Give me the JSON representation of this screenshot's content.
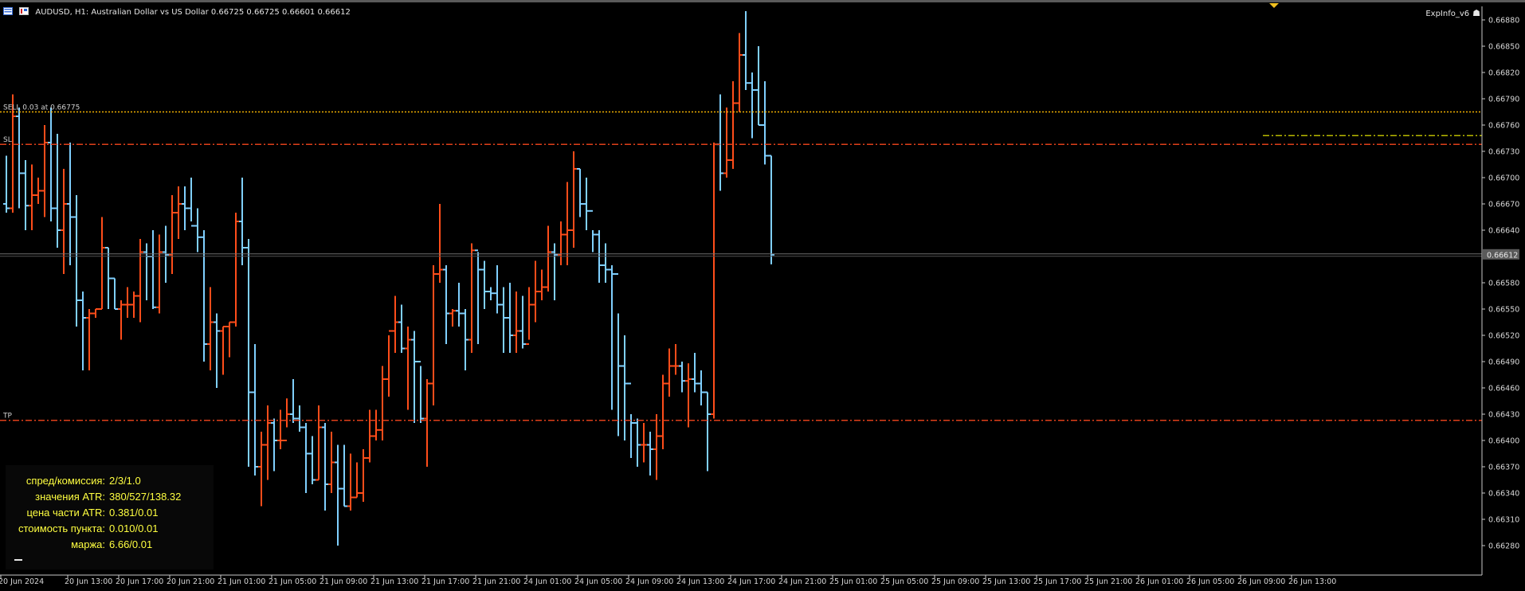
{
  "window": {
    "symbol_title": "AUDUSD, H1:  Australian Dollar vs US Dollar  0.66725 0.66725 0.66601 0.66612",
    "indicator_label": "ExpInfo_v6"
  },
  "levels": {
    "sell": {
      "label": "SELL 0.03 at 0.66775",
      "price": 0.66775,
      "color": "#f0b000"
    },
    "sl": {
      "label": "SL",
      "price": 0.66738,
      "color": "#e0401a"
    },
    "tp": {
      "label": "TP",
      "price": 0.66423,
      "color": "#e0401a"
    },
    "bid": {
      "label": "0.66612",
      "price": 0.66612,
      "color": "#8a8a8a"
    },
    "extra_dash_color": "#b8b800"
  },
  "colors": {
    "bull": "#ff4d1a",
    "bear": "#80d0ff",
    "grid_text": "#d8d8d8",
    "panel_text": "#ffff40"
  },
  "info_panel": [
    {
      "label": "спред/комиссия:",
      "value": "2/3/1.0"
    },
    {
      "label": "значения ATR:",
      "value": "380/527/138.32"
    },
    {
      "label": "цена части ATR:",
      "value": "0.381/0.01"
    },
    {
      "label": "стоимость пункта:",
      "value": "0.010/0.01"
    },
    {
      "label": "маржа:",
      "value": "6.66/0.01"
    }
  ],
  "chart_data": {
    "type": "ohlc",
    "title": "AUDUSD, H1",
    "y_ticks": [
      "0.66880",
      "0.66850",
      "0.66820",
      "0.66790",
      "0.66760",
      "0.66730",
      "0.66700",
      "0.66670",
      "0.66640",
      "0.66580",
      "0.66550",
      "0.66520",
      "0.66490",
      "0.66460",
      "0.66430",
      "0.66400",
      "0.66370",
      "0.66340",
      "0.66310",
      "0.66280"
    ],
    "ylim": [
      0.6625,
      0.66895
    ],
    "x_ticks": [
      "20 Jun 2024",
      "20 Jun 13:00",
      "20 Jun 17:00",
      "20 Jun 21:00",
      "21 Jun 01:00",
      "21 Jun 05:00",
      "21 Jun 09:00",
      "21 Jun 13:00",
      "21 Jun 17:00",
      "21 Jun 21:00",
      "24 Jun 01:00",
      "24 Jun 05:00",
      "24 Jun 09:00",
      "24 Jun 13:00",
      "24 Jun 17:00",
      "24 Jun 21:00",
      "25 Jun 01:00",
      "25 Jun 05:00",
      "25 Jun 09:00",
      "25 Jun 13:00",
      "25 Jun 17:00",
      "25 Jun 21:00",
      "26 Jun 01:00",
      "26 Jun 05:00",
      "26 Jun 09:00",
      "26 Jun 13:00"
    ],
    "bars": [
      [
        0.6667,
        0.66725,
        0.6666,
        0.66665
      ],
      [
        0.66665,
        0.66795,
        0.6666,
        0.6677
      ],
      [
        0.6677,
        0.6678,
        0.66665,
        0.66705
      ],
      [
        0.66705,
        0.6672,
        0.6664,
        0.66668
      ],
      [
        0.66668,
        0.66715,
        0.6664,
        0.6668
      ],
      [
        0.6668,
        0.667,
        0.6667,
        0.66685
      ],
      [
        0.66685,
        0.6676,
        0.66655,
        0.6674
      ],
      [
        0.6674,
        0.6678,
        0.6665,
        0.66665
      ],
      [
        0.66665,
        0.6675,
        0.6662,
        0.6664
      ],
      [
        0.6664,
        0.6671,
        0.6659,
        0.6667
      ],
      [
        0.6667,
        0.6674,
        0.666,
        0.66655
      ],
      [
        0.66655,
        0.6668,
        0.6653,
        0.6656
      ],
      [
        0.6656,
        0.6657,
        0.6648,
        0.6654
      ],
      [
        0.6654,
        0.6655,
        0.6648,
        0.66545
      ],
      [
        0.66545,
        0.6655,
        0.6654,
        0.6655
      ],
      [
        0.6655,
        0.66655,
        0.6655,
        0.6662
      ],
      [
        0.6662,
        0.6662,
        0.6655,
        0.66585
      ],
      [
        0.66585,
        0.66585,
        0.6655,
        0.6655
      ],
      [
        0.6655,
        0.6656,
        0.66515,
        0.66555
      ],
      [
        0.66555,
        0.66575,
        0.6654,
        0.66555
      ],
      [
        0.66555,
        0.6657,
        0.6654,
        0.66565
      ],
      [
        0.66565,
        0.6663,
        0.66535,
        0.66615
      ],
      [
        0.66615,
        0.66625,
        0.6656,
        0.6661
      ],
      [
        0.6661,
        0.6664,
        0.6655,
        0.66552
      ],
      [
        0.66552,
        0.66635,
        0.66545,
        0.66615
      ],
      [
        0.66615,
        0.66645,
        0.6658,
        0.66612
      ],
      [
        0.66612,
        0.6668,
        0.6659,
        0.6666
      ],
      [
        0.6666,
        0.6669,
        0.6663,
        0.6667
      ],
      [
        0.6667,
        0.6669,
        0.6664,
        0.66665
      ],
      [
        0.66665,
        0.667,
        0.6665,
        0.66645
      ],
      [
        0.66645,
        0.66665,
        0.66615,
        0.66632
      ],
      [
        0.66632,
        0.6664,
        0.6649,
        0.6651
      ],
      [
        0.6651,
        0.66575,
        0.6648,
        0.66535
      ],
      [
        0.66535,
        0.66545,
        0.6646,
        0.66525
      ],
      [
        0.66525,
        0.6653,
        0.66475,
        0.6653
      ],
      [
        0.6653,
        0.66535,
        0.66495,
        0.66535
      ],
      [
        0.66535,
        0.6666,
        0.6653,
        0.6665
      ],
      [
        0.6665,
        0.667,
        0.666,
        0.6662
      ],
      [
        0.6662,
        0.6663,
        0.6637,
        0.66455
      ],
      [
        0.66455,
        0.6651,
        0.6636,
        0.6637
      ],
      [
        0.6637,
        0.6641,
        0.66325,
        0.66395
      ],
      [
        0.66395,
        0.6644,
        0.66355,
        0.6642
      ],
      [
        0.6642,
        0.66425,
        0.66365,
        0.664
      ],
      [
        0.664,
        0.66435,
        0.6639,
        0.664
      ],
      [
        0.664,
        0.66448,
        0.66415,
        0.6643
      ],
      [
        0.6643,
        0.6647,
        0.6642,
        0.66425
      ],
      [
        0.66425,
        0.6644,
        0.6641,
        0.66415
      ],
      [
        0.66415,
        0.6642,
        0.6634,
        0.66385
      ],
      [
        0.66385,
        0.66405,
        0.6635,
        0.66355
      ],
      [
        0.66355,
        0.6644,
        0.66355,
        0.66415
      ],
      [
        0.66415,
        0.6642,
        0.6632,
        0.6635
      ],
      [
        0.6635,
        0.6641,
        0.6634,
        0.66375
      ],
      [
        0.66375,
        0.66395,
        0.6628,
        0.66345
      ],
      [
        0.66345,
        0.66395,
        0.66325,
        0.66325
      ],
      [
        0.66325,
        0.66385,
        0.6632,
        0.66335
      ],
      [
        0.66335,
        0.66375,
        0.66335,
        0.6634
      ],
      [
        0.6634,
        0.6639,
        0.6633,
        0.6638
      ],
      [
        0.6638,
        0.66435,
        0.66375,
        0.66405
      ],
      [
        0.66405,
        0.66435,
        0.664,
        0.66412
      ],
      [
        0.66412,
        0.66485,
        0.664,
        0.6647
      ],
      [
        0.6647,
        0.6652,
        0.6645,
        0.66525
      ],
      [
        0.66525,
        0.66565,
        0.665,
        0.66535
      ],
      [
        0.66535,
        0.66555,
        0.665,
        0.66505
      ],
      [
        0.66505,
        0.6653,
        0.66435,
        0.66515
      ],
      [
        0.66515,
        0.66525,
        0.6642,
        0.6649
      ],
      [
        0.6649,
        0.66485,
        0.6642,
        0.66425
      ],
      [
        0.66425,
        0.6647,
        0.6637,
        0.66465
      ],
      [
        0.66465,
        0.666,
        0.6644,
        0.6659
      ],
      [
        0.6659,
        0.6667,
        0.6658,
        0.66595
      ],
      [
        0.66595,
        0.666,
        0.6651,
        0.66545
      ],
      [
        0.66545,
        0.6655,
        0.6653,
        0.66548
      ],
      [
        0.66548,
        0.6658,
        0.6653,
        0.66545
      ],
      [
        0.66545,
        0.6655,
        0.6648,
        0.66515
      ],
      [
        0.66515,
        0.66625,
        0.665,
        0.66617
      ],
      [
        0.66617,
        0.66615,
        0.6651,
        0.66595
      ],
      [
        0.66595,
        0.66605,
        0.6655,
        0.6657
      ],
      [
        0.6657,
        0.66575,
        0.6656,
        0.66568
      ],
      [
        0.66568,
        0.666,
        0.66545,
        0.66555
      ],
      [
        0.66555,
        0.66575,
        0.665,
        0.6654
      ],
      [
        0.6654,
        0.6658,
        0.665,
        0.6652
      ],
      [
        0.6652,
        0.6657,
        0.665,
        0.66525
      ],
      [
        0.66525,
        0.66565,
        0.66505,
        0.6651
      ],
      [
        0.6651,
        0.66575,
        0.66515,
        0.66555
      ],
      [
        0.66555,
        0.66605,
        0.66535,
        0.6657
      ],
      [
        0.6657,
        0.66595,
        0.6656,
        0.66575
      ],
      [
        0.66575,
        0.66645,
        0.6657,
        0.66615
      ],
      [
        0.66615,
        0.66625,
        0.6656,
        0.66612
      ],
      [
        0.66612,
        0.6665,
        0.666,
        0.66635
      ],
      [
        0.66635,
        0.66695,
        0.666,
        0.6664
      ],
      [
        0.6664,
        0.6673,
        0.6662,
        0.6671
      ],
      [
        0.6671,
        0.6671,
        0.66655,
        0.6667
      ],
      [
        0.6667,
        0.667,
        0.6664,
        0.66662
      ],
      [
        0.66662,
        0.6664,
        0.66615,
        0.66635
      ],
      [
        0.66635,
        0.6664,
        0.6658,
        0.666
      ],
      [
        0.666,
        0.66625,
        0.6658,
        0.66595
      ],
      [
        0.66595,
        0.666,
        0.66435,
        0.6659
      ],
      [
        0.6659,
        0.66545,
        0.66405,
        0.66485
      ],
      [
        0.66485,
        0.6652,
        0.664,
        0.66465
      ],
      [
        0.66465,
        0.6643,
        0.6638,
        0.6642
      ],
      [
        0.6642,
        0.66425,
        0.6637,
        0.66395
      ],
      [
        0.66395,
        0.6642,
        0.66375,
        0.66395
      ],
      [
        0.66395,
        0.6641,
        0.6636,
        0.6639
      ],
      [
        0.6639,
        0.6643,
        0.66355,
        0.66405
      ],
      [
        0.66405,
        0.66475,
        0.6639,
        0.66465
      ],
      [
        0.66465,
        0.66505,
        0.6645,
        0.66485
      ],
      [
        0.66485,
        0.6651,
        0.66475,
        0.66485
      ],
      [
        0.66485,
        0.6649,
        0.66455,
        0.66468
      ],
      [
        0.66468,
        0.66488,
        0.66415,
        0.6647
      ],
      [
        0.6647,
        0.665,
        0.66455,
        0.66465
      ],
      [
        0.66465,
        0.6648,
        0.6644,
        0.66455
      ],
      [
        0.66455,
        0.66455,
        0.66365,
        0.6643
      ],
      [
        0.6643,
        0.6674,
        0.66425,
        0.66738
      ],
      [
        0.66738,
        0.66795,
        0.66685,
        0.66705
      ],
      [
        0.66705,
        0.6678,
        0.667,
        0.6672
      ],
      [
        0.6672,
        0.6681,
        0.6671,
        0.66785
      ],
      [
        0.66785,
        0.66865,
        0.66775,
        0.6684
      ],
      [
        0.6684,
        0.6689,
        0.668,
        0.66808
      ],
      [
        0.66808,
        0.6682,
        0.66745,
        0.668
      ],
      [
        0.668,
        0.6685,
        0.6676,
        0.6676
      ],
      [
        0.6676,
        0.6681,
        0.66715,
        0.66725
      ],
      [
        0.66725,
        0.66725,
        0.66601,
        0.66612
      ]
    ]
  }
}
